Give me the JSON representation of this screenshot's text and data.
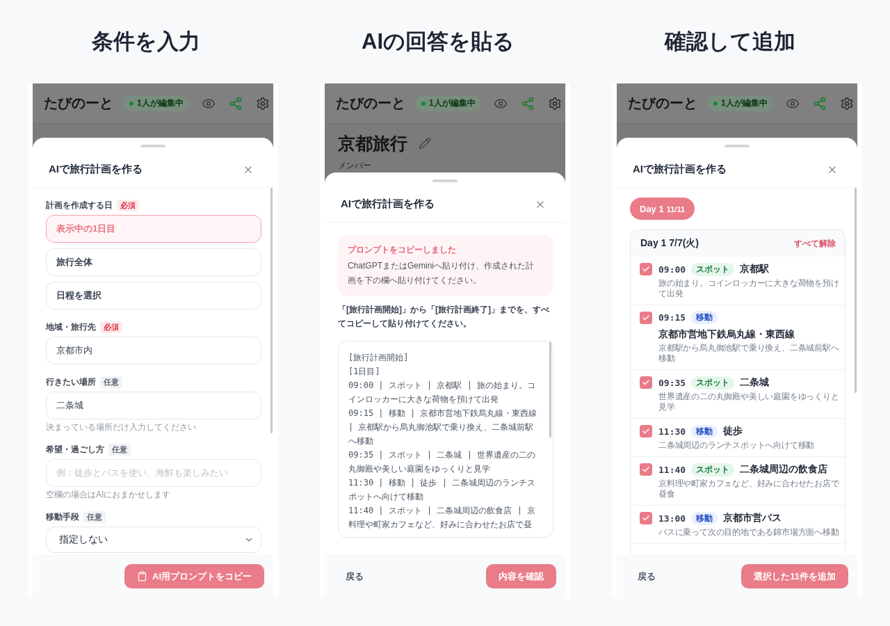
{
  "steps": [
    {
      "heading": "条件を入力",
      "app": {
        "name": "たびのーと",
        "editing_badge": "1人が編集中"
      },
      "sheet": {
        "kind": "form",
        "title": "AIで旅行計画を作る",
        "fields": [
          {
            "kind": "choices",
            "label": "計画を作成する日",
            "badge": {
              "text": "必須",
              "required": true
            },
            "options": [
              {
                "label": "表示中の1日目",
                "selected": true
              },
              {
                "label": "旅行全体",
                "selected": false
              },
              {
                "label": "日程を選択",
                "selected": false
              }
            ]
          },
          {
            "kind": "text",
            "label": "地域・旅行先",
            "badge": {
              "text": "必須",
              "required": true
            },
            "value": "京都市内"
          },
          {
            "kind": "text",
            "label": "行きたい場所",
            "badge": {
              "text": "任意",
              "required": false
            },
            "value": "二条城",
            "hint": "決まっている場所だけ入力してください"
          },
          {
            "kind": "text",
            "label": "希望・過ごし方",
            "badge": {
              "text": "任意",
              "required": false
            },
            "placeholder": "例：徒歩とバスを使い、海鮮も楽しみたい",
            "hint": "空欄の場合はAIにおまかせします"
          },
          {
            "kind": "select",
            "label": "移動手段",
            "badge": {
              "text": "任意",
              "required": false
            },
            "value": "指定しない"
          }
        ],
        "footer": {
          "primary": {
            "label": "AI用プロンプトをコピー",
            "kind": "copy"
          }
        }
      }
    },
    {
      "heading": "AIの回答を貼る",
      "app": {
        "name": "たびのーと",
        "editing_badge": "1人が編集中"
      },
      "trip": {
        "title": "京都旅行",
        "members_label": "メンバー"
      },
      "sheet": {
        "kind": "paste",
        "title": "AIで旅行計画を作る",
        "notice": {
          "title": "プロンプトをコピーしました",
          "text": "ChatGPTまたはGeminiへ貼り付け、作成された計画を下の欄へ貼り付けてください。"
        },
        "instruction": "「[旅行計画開始]」から「[旅行計画終了]」までを、すべてコピーして貼り付けてください。",
        "pasted_text": "[旅行計画開始]\n[1日目]\n09:00 | スポット | 京都駅 | 旅の始まり。コインロッカーに大きな荷物を預けて出発\n09:15 | 移動 | 京都市営地下鉄烏丸線・東西線 | 京都駅から烏丸御池駅で乗り換え、二条城前駅へ移動\n09:35 | スポット | 二条城 | 世界遺産の二の丸御殿や美しい庭園をゆっくりと見学\n11:30 | 移動 | 徒歩 | 二条城周辺のランチスポットへ向けて移動\n11:40 | スポット | 二条城周辺の飲食店 | 京料理や町家カフェなど、好みに合わせたお店で昼",
        "footer": {
          "back": "戻る",
          "primary": {
            "label": "内容を確認",
            "kind": "confirm"
          }
        }
      }
    },
    {
      "heading": "確認して追加",
      "app": {
        "name": "たびのーと",
        "editing_badge": "1人が編集中"
      },
      "sheet": {
        "kind": "review",
        "title": "AIで旅行計画を作る",
        "day_tabs": [
          {
            "label": "Day 1",
            "count": "11/11",
            "selected": true
          }
        ],
        "day_card": {
          "title": "Day 1 7/7(火)",
          "action": "すべて解除",
          "items": [
            {
              "checked": true,
              "time": "09:00",
              "kind": "spot",
              "tag": "スポット",
              "title": "京都駅",
              "note": "旅の始まり。コインロッカーに大きな荷物を預けて出発"
            },
            {
              "checked": true,
              "time": "09:15",
              "kind": "move",
              "tag": "移動",
              "title": "京都市営地下鉄烏丸線・東西線",
              "note": "京都駅から烏丸御池駅で乗り換え、二条城前駅へ移動"
            },
            {
              "checked": true,
              "time": "09:35",
              "kind": "spot",
              "tag": "スポット",
              "title": "二条城",
              "note": "世界遺産の二の丸御殿や美しい庭園をゆっくりと見学"
            },
            {
              "checked": true,
              "time": "11:30",
              "kind": "move",
              "tag": "移動",
              "title": "徒歩",
              "note": "二条城周辺のランチスポットへ向けて移動"
            },
            {
              "checked": true,
              "time": "11:40",
              "kind": "spot",
              "tag": "スポット",
              "title": "二条城周辺の飲食店",
              "note": "京料理や町家カフェなど、好みに合わせたお店で昼食"
            },
            {
              "checked": true,
              "time": "13:00",
              "kind": "move",
              "tag": "移動",
              "title": "京都市営バス",
              "note": "バスに乗って次の目的地である錦市場方面へ移動"
            }
          ]
        },
        "footer": {
          "back": "戻る",
          "primary": {
            "label": "選択した11件を追加",
            "kind": "add"
          }
        }
      }
    }
  ]
}
